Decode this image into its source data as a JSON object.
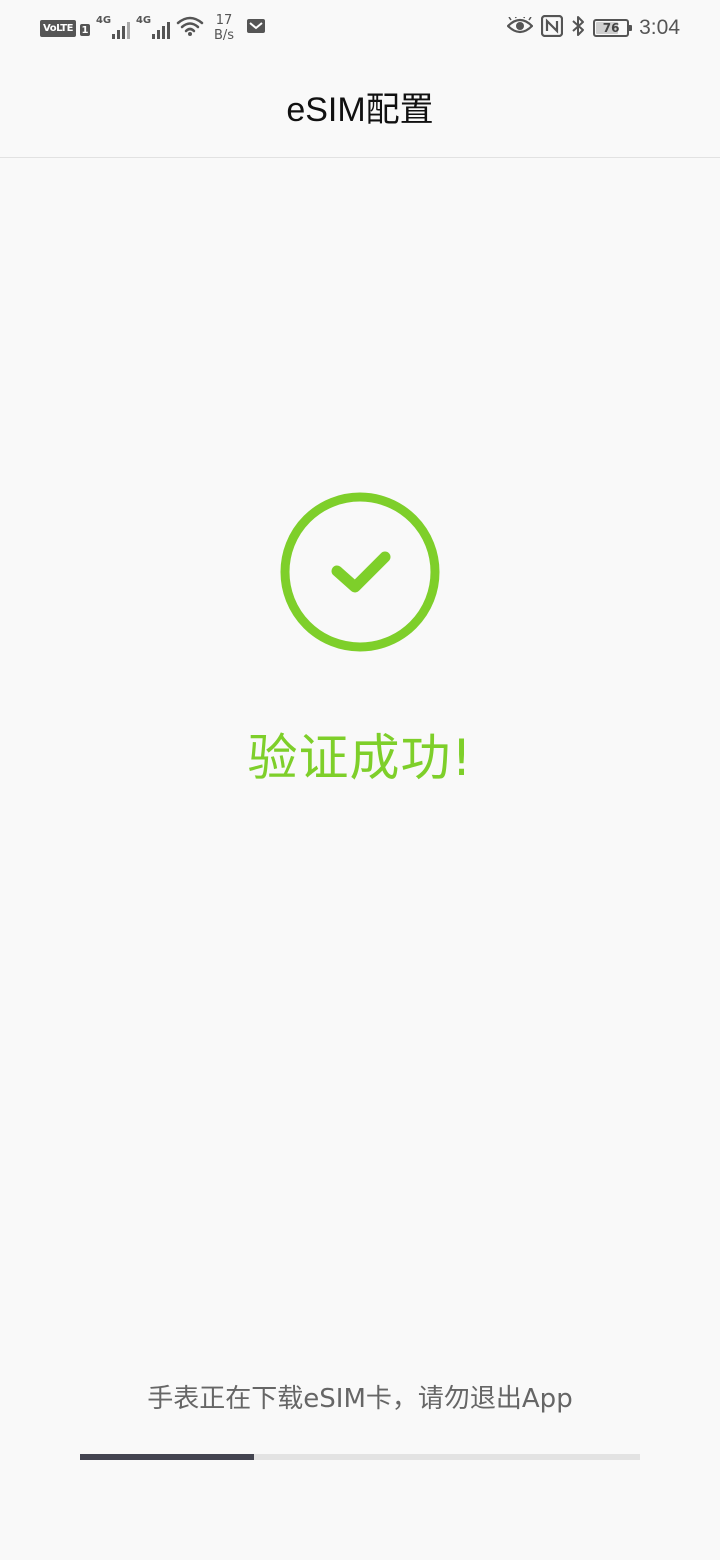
{
  "status_bar": {
    "volte_label": "VoLTE",
    "sim_number": "1",
    "sim1_network": "4G",
    "sim2_network": "4G",
    "speed_value": "17",
    "speed_unit": "B/s",
    "battery_level": "76",
    "time": "3:04",
    "icons": [
      "volte-icon",
      "signal-icon",
      "wifi-icon",
      "mail-icon",
      "eye-icon",
      "nfc-icon",
      "bluetooth-icon",
      "battery-icon"
    ]
  },
  "header": {
    "title": "eSIM配置"
  },
  "main": {
    "success_icon": "check-circle-icon",
    "success_text": "验证成功!",
    "accent_color": "#7ecf2a"
  },
  "footer": {
    "hint": "手表正在下载eSIM卡，请勿退出App",
    "progress_fraction": 0.31,
    "progress_color": "#434450"
  }
}
